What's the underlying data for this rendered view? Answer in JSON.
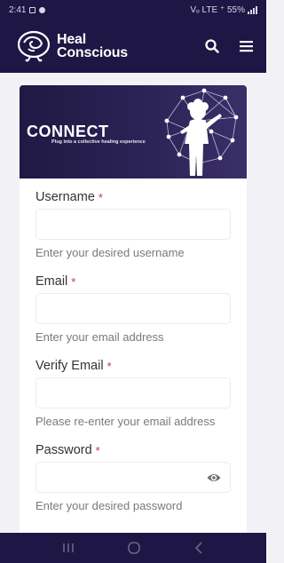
{
  "status_bar": {
    "time": "2:41",
    "right_text": "Vₒ LTE ⁺ 55%"
  },
  "header": {
    "logo_line1": "Heal",
    "logo_line2": "Conscious"
  },
  "banner": {
    "title": "CONNECT",
    "subtitle": "Plug into a collective healing experience"
  },
  "form": {
    "required_mark": "*",
    "fields": [
      {
        "label": "Username",
        "value": "",
        "hint": "Enter your desired username"
      },
      {
        "label": "Email",
        "value": "",
        "hint": "Enter your email address"
      },
      {
        "label": "Verify Email",
        "value": "",
        "hint": "Please re-enter your email address"
      },
      {
        "label": "Password",
        "value": "",
        "hint": "Enter your desired password"
      }
    ]
  },
  "icons": {
    "logo": "brain-logo-icon",
    "search": "search-icon",
    "menu": "hamburger-menu-icon",
    "eye": "eye-icon",
    "nav_recents": "recents-icon",
    "nav_home": "home-icon",
    "nav_back": "back-icon"
  },
  "colors": {
    "brand": "#1e1644",
    "required": "#c8363a",
    "background": "#f2f2f6"
  }
}
